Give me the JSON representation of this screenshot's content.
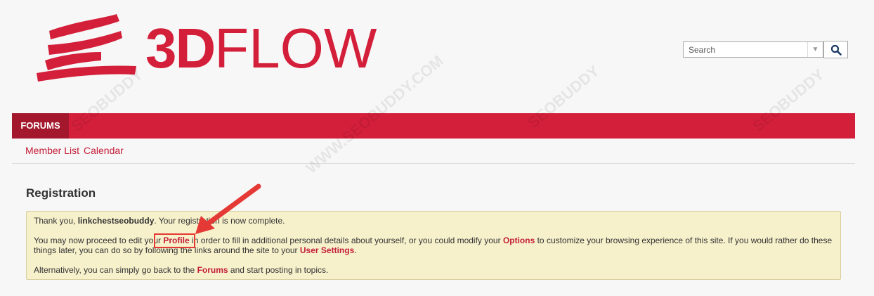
{
  "logo": {
    "text_bold": "3D",
    "text_thin": "FLOW"
  },
  "search": {
    "placeholder": "Search"
  },
  "nav": {
    "forums_tab": "FORUMS"
  },
  "subnav": {
    "member_list": "Member List",
    "calendar": "Calendar"
  },
  "page": {
    "title": "Registration"
  },
  "notice": {
    "p1_a": "Thank you, ",
    "username": "linkchestseobuddy",
    "p1_b": ". Your registration is now complete.",
    "p2_a": "You may now proceed to edit your ",
    "profile_link": "Profile",
    "p2_b": " in order to fill in additional personal details about yourself, or you could modify your ",
    "options_link": "Options",
    "p2_c": " to customize your browsing experience of this site. If you would rather do these things later, you can do so by following the links around the site to your ",
    "user_settings_link": "User Settings",
    "p2_d": ".",
    "p3_a": "Alternatively, you can simply go back to the ",
    "forums_link": "Forums",
    "p3_b": " and start posting in topics."
  },
  "watermark": {
    "text": "SEOBUDDY",
    "sub": "WWW.SEOBUDDY.COM"
  },
  "colors": {
    "brand": "#d41f3a",
    "brand_dark": "#a3182d",
    "notice_bg": "#f6f0cb",
    "annotation": "#e53935"
  }
}
